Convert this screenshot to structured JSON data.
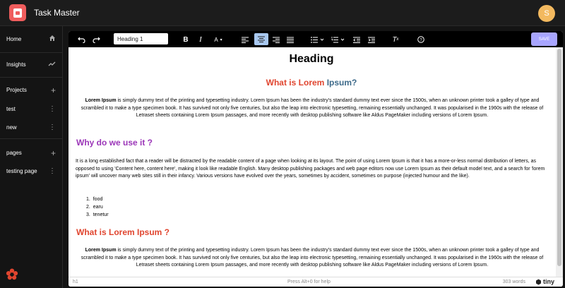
{
  "app": {
    "title": "Task Master",
    "avatar_letter": "S"
  },
  "sidebar": {
    "home": "Home",
    "insights": "Insights",
    "projects": "Projects",
    "project_items": [
      "test",
      "new"
    ],
    "pages": "pages",
    "page_items": [
      "testing page"
    ]
  },
  "toolbar": {
    "format": "Heading 1",
    "save": "SAVE"
  },
  "doc": {
    "heading": "Heading",
    "h2_what": "What is",
    "h2_lorem": "Lorem",
    "h2_ipsum": "Ipsum?",
    "p1_bold": "Lorem Ipsum",
    "p1_text": " is simply dummy text of the printing and typesetting industry. Lorem Ipsum has been the industry's standard dummy text ever since the 1500s, when an unknown printer took a galley of type and scrambled it to make a type specimen book. It has survived not only five centuries, but also the leap into electronic typesetting, remaining essentially unchanged. It was popularised in the 1960s with the release of Letraset sheets containing Lorem Ipsum passages, and more recently with desktop publishing software like Aldus PageMaker including versions of Lorem Ipsum.",
    "why": "Why do we use it ?",
    "p2": "It is a long established fact that a reader will be distracted by the readable content of a page when looking at its layout. The point of using Lorem Ipsum is that it has a more-or-less normal distribution of letters, as opposed to using 'Content here, content here', making it look like readable English. Many desktop publishing packages and web page editors now use Lorem Ipsum as their default model text, and a search for 'lorem ipsum' will uncover many web sites still in their infancy. Various versions have evolved over the years, sometimes by accident, sometimes on purpose (injected humour and the like).",
    "list": [
      "food",
      "earu",
      "tenetur"
    ],
    "h3": "What is Lorem Ipsum ?",
    "p3_bold": "Lorem Ipsum",
    "p3_text": " is simply dummy text of the printing and typesetting industry. Lorem Ipsum has been the industry's standard dummy text ever since the 1500s, when an unknown printer took a galley of type and scrambled it to make a type specimen book. It has survived not only five centuries, but also the leap into electronic typesetting, remaining essentially unchanged. It was popularised in the 1960s with the release of Letraset sheets containing Lorem Ipsum passages, and more recently with desktop publishing software like Aldus PageMaker including versions of Lorem Ipsum."
  },
  "status": {
    "element_path": "h1",
    "help": "Press Alt+0 for help",
    "words": "303 words",
    "brand": "tiny"
  },
  "colors": {
    "accent_red": "#e0452f",
    "accent_purple": "#9b36b8",
    "save_button": "#a8a5ff",
    "avatar": "#f3b95f"
  }
}
